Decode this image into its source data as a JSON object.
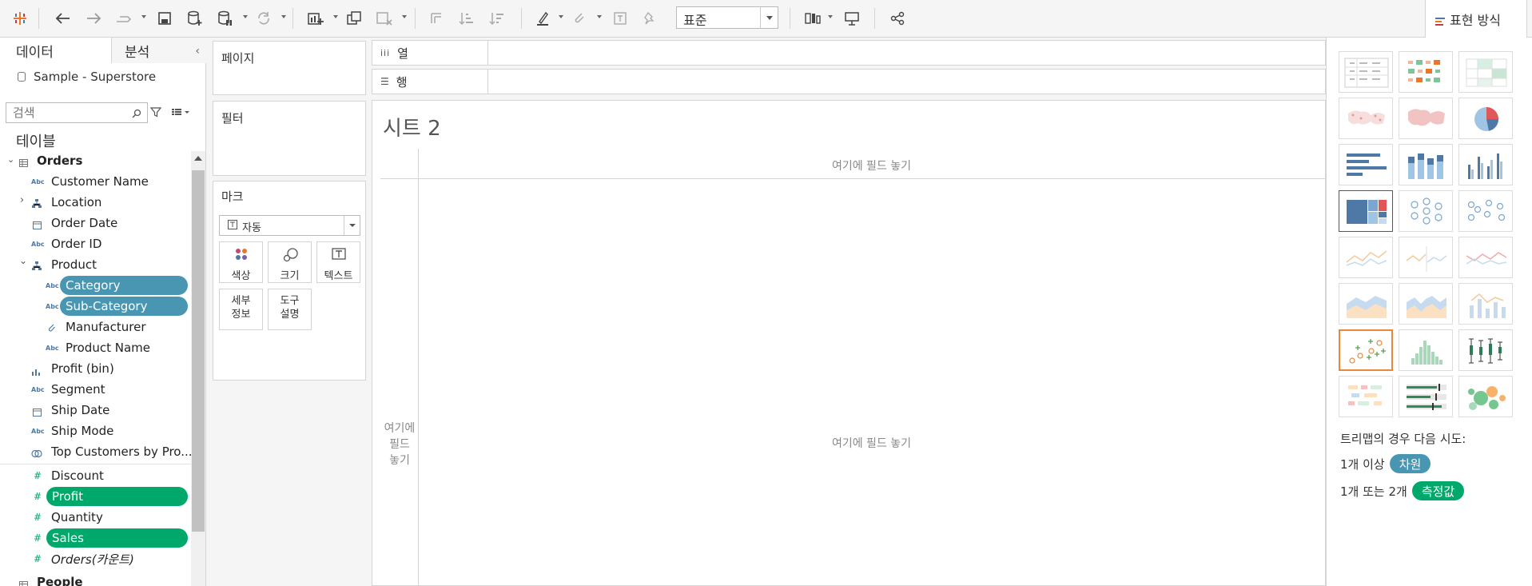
{
  "toolbar": {
    "fit_value": "표준",
    "show_me_label": "표현 방식"
  },
  "data_pane": {
    "tab_data": "데이터",
    "tab_analytics": "분석",
    "datasource": "Sample - Superstore",
    "search_placeholder": "검색",
    "section_tables": "테이블",
    "table_name": "Orders",
    "fields": [
      {
        "label": "Customer Name",
        "type": "Abc"
      },
      {
        "label": "Location",
        "type": "hier"
      },
      {
        "label": "Order Date",
        "type": "date"
      },
      {
        "label": "Order ID",
        "type": "Abc"
      },
      {
        "label": "Product",
        "type": "hier"
      },
      {
        "label": "Category",
        "type": "Abc"
      },
      {
        "label": "Sub-Category",
        "type": "Abc"
      },
      {
        "label": "Manufacturer",
        "type": "clip"
      },
      {
        "label": "Product Name",
        "type": "Abc"
      },
      {
        "label": "Profit (bin)",
        "type": "bin"
      },
      {
        "label": "Segment",
        "type": "Abc"
      },
      {
        "label": "Ship Date",
        "type": "date"
      },
      {
        "label": "Ship Mode",
        "type": "Abc"
      },
      {
        "label": "Top Customers by Pro...",
        "type": "set"
      },
      {
        "label": "Discount",
        "type": "#"
      },
      {
        "label": "Profit",
        "type": "#"
      },
      {
        "label": "Quantity",
        "type": "#"
      },
      {
        "label": "Sales",
        "type": "#"
      },
      {
        "label": "Orders(카운트)",
        "type": "#"
      }
    ],
    "next_table": "People"
  },
  "cards": {
    "pages": "페이지",
    "filters": "필터",
    "marks": "마크",
    "mark_type": "자동",
    "color": "색상",
    "size": "크기",
    "text": "텍스트",
    "detail_1": "세부",
    "detail_2": "정보",
    "tooltip_1": "도구",
    "tooltip_2": "설명"
  },
  "view": {
    "columns_label": "열",
    "rows_label": "행",
    "sheet_title": "시트 2",
    "drop_field_here": "여기에 필드 놓기",
    "row_drop_1": "여기에",
    "row_drop_2": "필드",
    "row_drop_3": "놓기"
  },
  "show_me": {
    "hint": "트리맵의 경우 다음 시도:",
    "req1_prefix": "1개 이상",
    "req1_badge": "차원",
    "req2_prefix": "1개 또는 2개",
    "req2_badge": "측정값"
  },
  "colors": {
    "dimension": "#4996b2",
    "measure": "#00a86b",
    "recommended_border": "#e8883a"
  }
}
